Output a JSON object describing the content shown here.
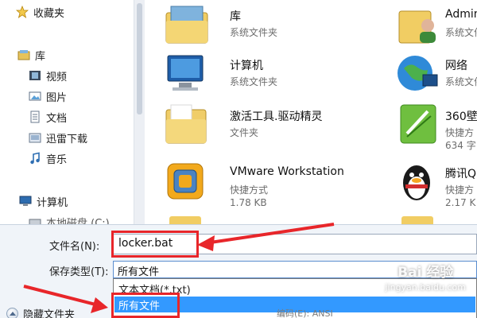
{
  "nav": {
    "items": [
      {
        "label": "收藏夹",
        "icon": "star-icon"
      },
      {
        "label": "库",
        "icon": "library-icon"
      },
      {
        "label": "视频",
        "icon": "video-icon"
      },
      {
        "label": "图片",
        "icon": "pictures-icon"
      },
      {
        "label": "文档",
        "icon": "documents-icon"
      },
      {
        "label": "迅雷下载",
        "icon": "download-icon"
      },
      {
        "label": "音乐",
        "icon": "music-icon"
      },
      {
        "label": "计算机",
        "icon": "computer-icon"
      },
      {
        "label": "本地磁盘 (C:)",
        "icon": "drive-icon"
      }
    ]
  },
  "files": [
    {
      "name": "库",
      "sub1": "系统文件夹",
      "sub2": "",
      "icon": "library-folder-icon"
    },
    {
      "name": "Admin",
      "sub1": "系统文件夹",
      "sub2": "",
      "icon": "user-folder-icon"
    },
    {
      "name": "计算机",
      "sub1": "系统文件夹",
      "sub2": "",
      "icon": "computer-icon"
    },
    {
      "name": "网络",
      "sub1": "系统文件夹",
      "sub2": "",
      "icon": "network-globe-icon"
    },
    {
      "name": "激活工具.驱动精灵",
      "sub1": "文件夹",
      "sub2": "",
      "icon": "folder-icon"
    },
    {
      "name": "360壁",
      "sub1": "快捷方",
      "sub2": "634 字",
      "icon": "360-wallpaper-icon"
    },
    {
      "name": "VMware Workstation",
      "sub1": "快捷方式",
      "sub2": "1.78 KB",
      "icon": "vmware-icon"
    },
    {
      "name": "腾讯Q",
      "sub1": "快捷方",
      "sub2": "2.17 K",
      "icon": "qq-penguin-icon"
    }
  ],
  "save": {
    "filename_label": "文件名(N):",
    "filename_value": "locker.bat",
    "type_label": "保存类型(T):",
    "type_value": "所有文件",
    "options": [
      "文本文档(*.txt)",
      "所有文件"
    ],
    "hide_folders_label": "隐藏文件夹",
    "encoding_label": "编码(E):",
    "encoding_value": "ANSI"
  },
  "watermark": {
    "brand": "Bai 经验",
    "url": "jingyan.baidu.com"
  },
  "colors": {
    "accent_red": "#e8262a",
    "selection_blue": "#3399ff",
    "panel_bg": "#f0f4f9"
  }
}
